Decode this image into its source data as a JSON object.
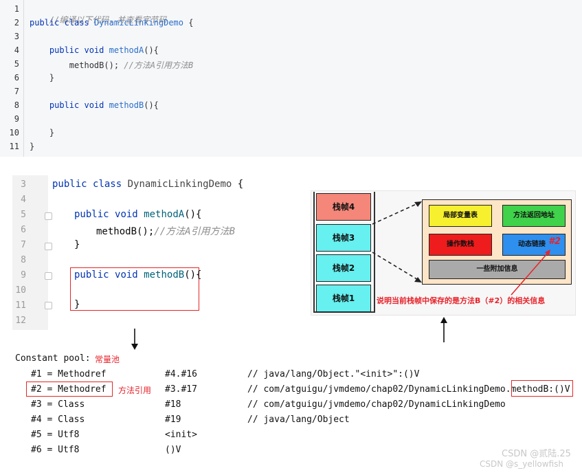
{
  "top_code": {
    "lines": [
      {
        "n": "1",
        "text": "//编译以下代码，并查看字节码"
      },
      {
        "n": "2",
        "text": "public class DynamicLinkingDemo {"
      },
      {
        "n": "3",
        "text": ""
      },
      {
        "n": "4",
        "text": "    public void methodA(){"
      },
      {
        "n": "5",
        "text": "        methodB(); //方法A引用方法B"
      },
      {
        "n": "6",
        "text": "    }"
      },
      {
        "n": "7",
        "text": ""
      },
      {
        "n": "8",
        "text": "    public void methodB(){"
      },
      {
        "n": "9",
        "text": ""
      },
      {
        "n": "10",
        "text": "    }"
      },
      {
        "n": "11",
        "text": "}"
      }
    ],
    "kw_public": "public",
    "kw_class": "class",
    "kw_void": "void",
    "class_name": "DynamicLinkingDemo",
    "method_a": "methodA",
    "method_b": "methodB",
    "call": "methodB();",
    "comment_header": "//编译以下代码，并查看字节码",
    "comment_call": "//方法A引用方法B"
  },
  "ide_code": {
    "line_numbers": [
      "3",
      "4",
      "5",
      "6",
      "7",
      "8",
      "9",
      "10",
      "11",
      "12"
    ],
    "comment": "//方法A引用方法B",
    "call": "methodB();"
  },
  "constant_pool": {
    "title": "Constant pool:",
    "title_note": "常量池",
    "entry_note": "方法引用",
    "entries": [
      {
        "idx": "#1 = Methodref",
        "ref": "#4.#16",
        "comment": "// java/lang/Object.\"<init>\":()V"
      },
      {
        "idx": "#2 = Methodref",
        "ref": "#3.#17",
        "comment_prefix": "// com/atguigu/jvmdemo/chap02/DynamicLinkingDemo",
        "comment_suffix": ".methodB:()V"
      },
      {
        "idx": "#3 = Class",
        "ref": "#18",
        "comment": "// com/atguigu/jvmdemo/chap02/DynamicLinkingDemo"
      },
      {
        "idx": "#4 = Class",
        "ref": "#19",
        "comment": "// java/lang/Object"
      },
      {
        "idx": "#5 = Utf8",
        "ref": "<init>",
        "comment": ""
      },
      {
        "idx": "#6 = Utf8",
        "ref": "()V",
        "comment": ""
      }
    ]
  },
  "stack_diagram": {
    "frames": [
      "栈帧4",
      "栈帧3",
      "栈帧2",
      "栈帧1"
    ],
    "local_vars": "局部变量表",
    "return_addr": "方法返回地址",
    "operand_stack": "操作数栈",
    "dynamic_link": "动态链接",
    "extra_info": "一些附加信息",
    "ref_tag": "#2",
    "caption": "说明当前栈帧中保存的是方法B（#2）的相关信息",
    "colors": {
      "frame_top": "#f4877a",
      "frame_other": "#66f0f0",
      "container": "#fde5c8",
      "local_vars": "#f7f02e",
      "return_addr": "#3fd24a",
      "operand_stack": "#ee1c1c",
      "dynamic_link": "#2e8fef",
      "extra_info": "#aaaaaa",
      "accent_red": "#e8232b"
    }
  },
  "watermark": {
    "line1": "CSDN @贰陆.25",
    "line2": "CSDN @s_yellowfish"
  }
}
